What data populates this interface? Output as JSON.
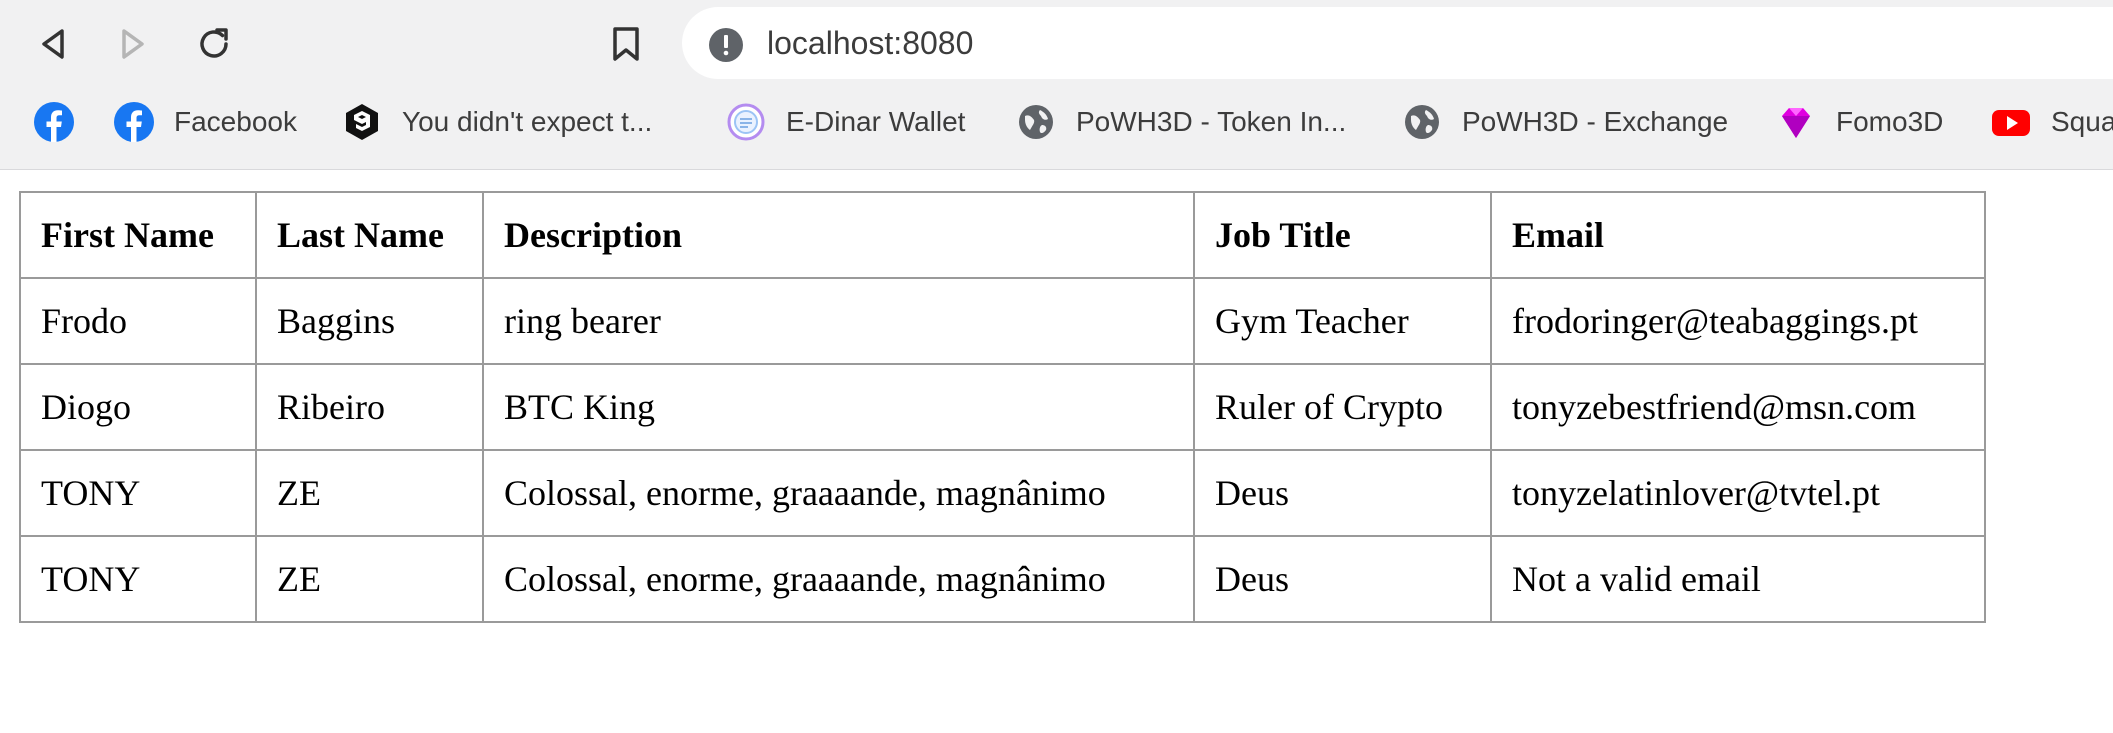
{
  "browser": {
    "url": "localhost:8080",
    "bookmarks": [
      {
        "label": "",
        "icon": "facebook-icon"
      },
      {
        "label": "Facebook",
        "icon": "facebook-icon"
      },
      {
        "label": "You didn't expect t...",
        "icon": "nine-gag-icon"
      },
      {
        "label": "E-Dinar Wallet",
        "icon": "edinar-icon"
      },
      {
        "label": "PoWH3D - Token In...",
        "icon": "globe-icon"
      },
      {
        "label": "PoWH3D - Exchange",
        "icon": "globe-icon"
      },
      {
        "label": "Fomo3D",
        "icon": "diamond-icon"
      },
      {
        "label": "Squa",
        "icon": "youtube-icon"
      }
    ],
    "colors": {
      "toolbar_bg": "#f1f1f2",
      "facebook": "#1877f2",
      "youtube": "#ff0000",
      "fomo": "#d400d4"
    }
  },
  "table": {
    "headers": [
      "First Name",
      "Last Name",
      "Description",
      "Job Title",
      "Email"
    ],
    "rows": [
      [
        "Frodo",
        "Baggins",
        "ring bearer",
        "Gym Teacher",
        "frodoringer@teabaggings.pt"
      ],
      [
        "Diogo",
        "Ribeiro",
        "BTC King",
        "Ruler of Crypto",
        "tonyzebestfriend@msn.com"
      ],
      [
        "TONY",
        "ZE",
        "Colossal, enorme, graaaande, magnânimo",
        "Deus",
        "tonyzelatinlover@tvtel.pt"
      ],
      [
        "TONY",
        "ZE",
        "Colossal, enorme, graaaande, magnânimo",
        "Deus",
        "Not a valid email"
      ]
    ]
  }
}
